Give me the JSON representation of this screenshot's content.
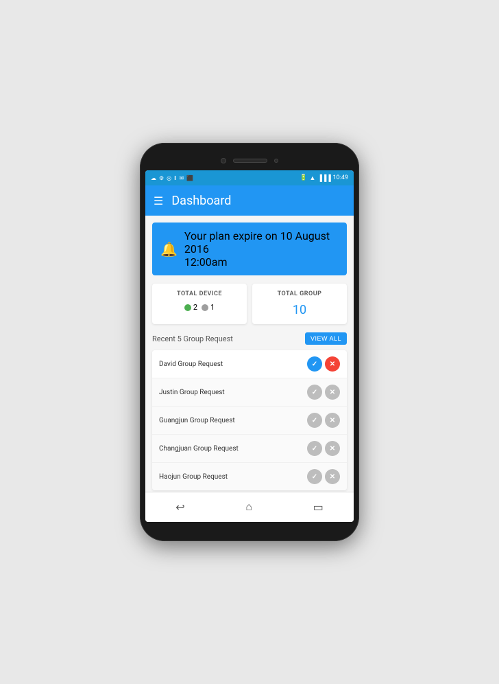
{
  "phone": {
    "status_bar": {
      "time": "10:49",
      "left_icons": [
        "☁",
        "⚙",
        "◎",
        "‖",
        "✉",
        "⬛"
      ],
      "right_icons": [
        "🔋",
        "📶",
        "📶"
      ]
    },
    "app_bar": {
      "menu_icon": "☰",
      "title": "Dashboard"
    },
    "notification": {
      "text_line1": "Your plan expire on 10 August 2016",
      "text_line2": "12:00am"
    },
    "total_device": {
      "label": "TOTAL DEVICE",
      "online_count": "2",
      "offline_count": "1"
    },
    "total_group": {
      "label": "TOTAL GROUP",
      "count": "10"
    },
    "recent_requests": {
      "section_title": "Recent 5 Group Request",
      "view_all_label": "VIEW ALL",
      "items": [
        {
          "name": "David Group Request",
          "primary": true
        },
        {
          "name": "Justin Group Request",
          "primary": false
        },
        {
          "name": "Guangjun Group Request",
          "primary": false
        },
        {
          "name": "Changjuan Group Request",
          "primary": false
        },
        {
          "name": "Haojun Group Request",
          "primary": false
        }
      ]
    },
    "nav": {
      "back_icon": "↩",
      "home_icon": "⌂",
      "recent_icon": "▭"
    }
  }
}
